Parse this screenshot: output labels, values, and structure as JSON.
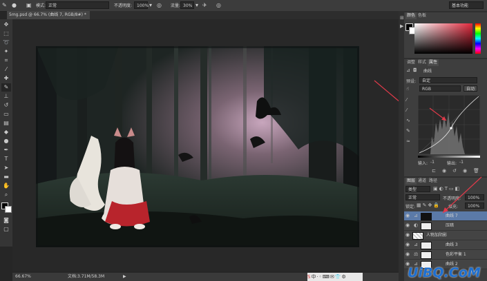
{
  "options_bar": {
    "mode_label": "模式:",
    "mode_value": "正常",
    "opacity_label": "不透明度:",
    "opacity_value": "100%",
    "flow_label": "流量:",
    "flow_value": "30%",
    "workspace_value": "基本功能"
  },
  "document": {
    "tab_title": "5mg.psd @ 66.7% (曲线 7, RGB/8#) *",
    "zoom": "66.67%",
    "doc_info": "文档:3.71M/58.3M"
  },
  "color_panel": {
    "tabs": [
      "颜色",
      "色板"
    ]
  },
  "properties_panel": {
    "tabs": [
      "调整",
      "样式",
      "属性"
    ],
    "title": "曲线",
    "preset_label": "预设:",
    "preset_value": "自定",
    "channel_value": "RGB",
    "auto_button": "自动",
    "input_label": "输入:",
    "input_value": "-1",
    "output_label": "输出:",
    "output_value": "-1"
  },
  "layers_panel": {
    "tabs": [
      "图层",
      "通道",
      "路径"
    ],
    "filter_value": "类型",
    "blend_value": "正常",
    "opacity_label": "不透明度:",
    "opacity_value": "100%",
    "lock_label": "锁定:",
    "fill_label": "填充:",
    "fill_value": "100%",
    "layers": [
      {
        "name": "曲线 7",
        "selected": true
      },
      {
        "name": "压暗"
      },
      {
        "name": "人物加阴影"
      },
      {
        "name": "曲线 3"
      },
      {
        "name": "色彩平衡 1"
      },
      {
        "name": "曲线 2"
      }
    ]
  },
  "watermark": "UiBQ.CoM",
  "colors": {
    "accent": "#3d5a8c",
    "annotation_arrow": "#e03a4a"
  }
}
